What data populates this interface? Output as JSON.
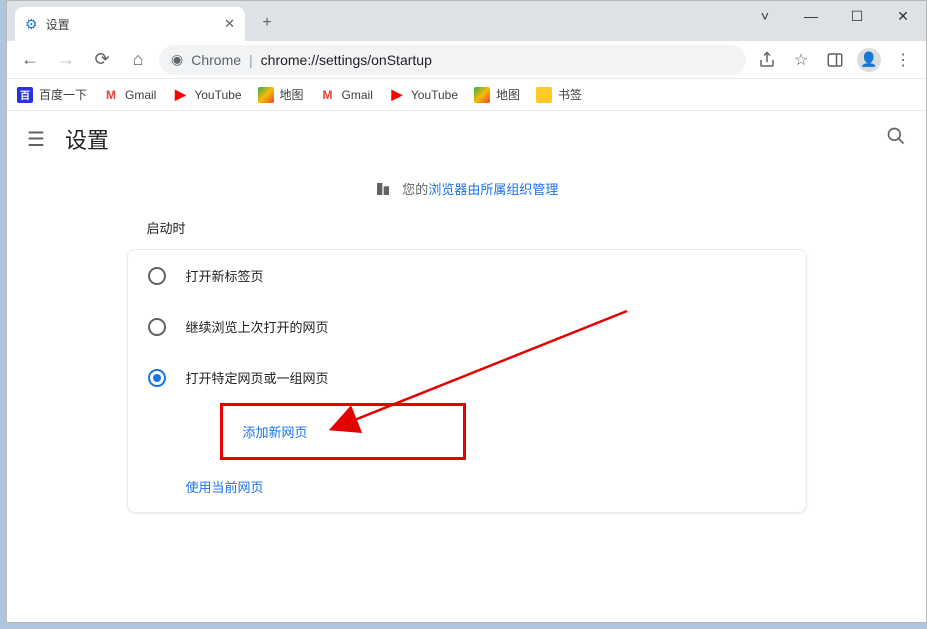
{
  "window": {
    "tab_title": "设置",
    "win_minimize": "v",
    "url_host": "Chrome",
    "url_sep": "|",
    "url_full": "chrome://settings/onStartup"
  },
  "bookmarks": [
    {
      "label": "百度一下",
      "icon": "baidu"
    },
    {
      "label": "Gmail",
      "icon": "gmail"
    },
    {
      "label": "YouTube",
      "icon": "youtube"
    },
    {
      "label": "地图",
      "icon": "maps"
    },
    {
      "label": "Gmail",
      "icon": "gmail"
    },
    {
      "label": "YouTube",
      "icon": "youtube"
    },
    {
      "label": "地图",
      "icon": "maps"
    },
    {
      "label": "书签",
      "icon": "folder"
    }
  ],
  "settings": {
    "title": "设置",
    "managed_prefix": "您的",
    "managed_link": "浏览器由所属组织管理",
    "section": "启动时",
    "options": [
      {
        "label": "打开新标签页",
        "selected": false
      },
      {
        "label": "继续浏览上次打开的网页",
        "selected": false
      },
      {
        "label": "打开特定网页或一组网页",
        "selected": true
      }
    ],
    "add_page": "添加新网页",
    "use_current": "使用当前网页"
  }
}
